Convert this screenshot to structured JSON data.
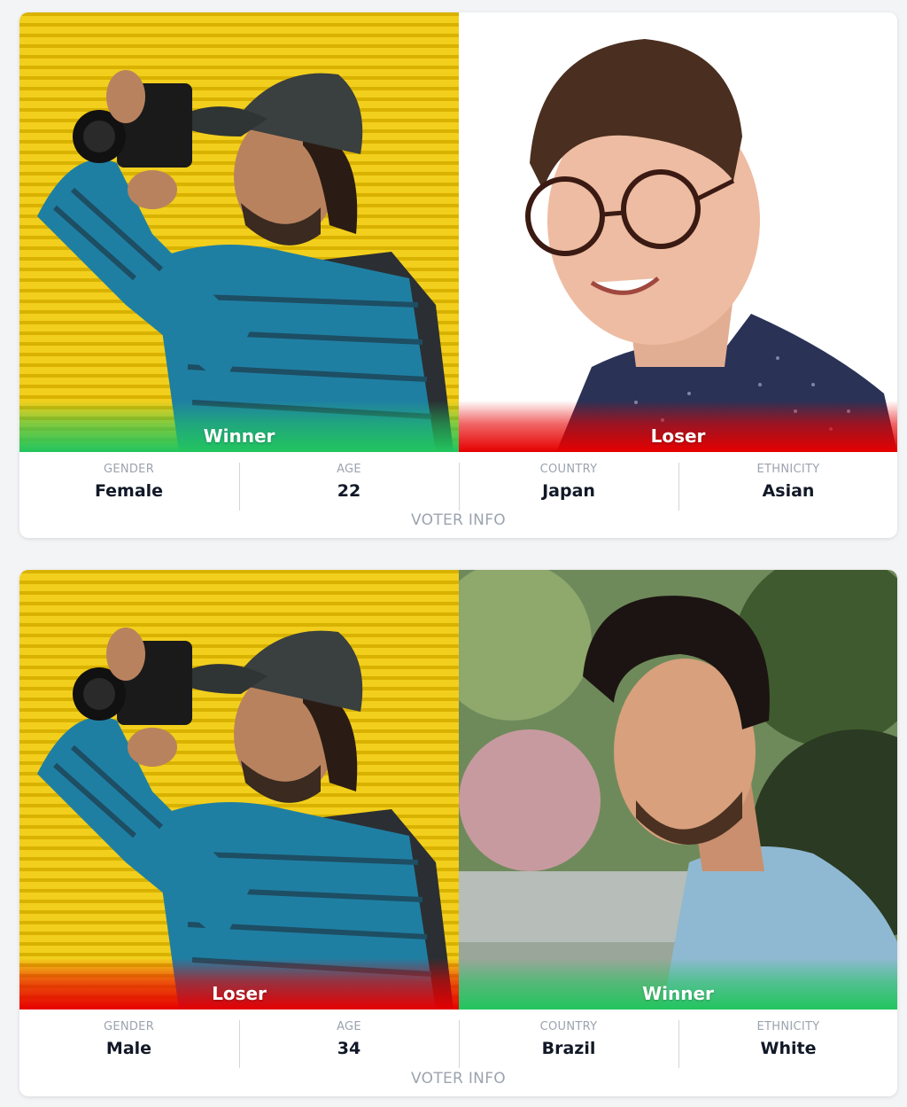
{
  "comparisons": [
    {
      "left": {
        "result": "Winner",
        "photo": "photographer-yellow-wall-photo"
      },
      "right": {
        "result": "Loser",
        "photo": "man-glasses-portrait-photo"
      },
      "stats": [
        {
          "key": "GENDER",
          "value": "Female"
        },
        {
          "key": "AGE",
          "value": "22"
        },
        {
          "key": "COUNTRY",
          "value": "Japan"
        },
        {
          "key": "ETHNICITY",
          "value": "Asian"
        }
      ],
      "footer": "VOTER INFO"
    },
    {
      "left": {
        "result": "Loser",
        "photo": "photographer-yellow-wall-photo"
      },
      "right": {
        "result": "Winner",
        "photo": "man-outdoor-portrait-photo"
      },
      "stats": [
        {
          "key": "GENDER",
          "value": "Male"
        },
        {
          "key": "AGE",
          "value": "34"
        },
        {
          "key": "COUNTRY",
          "value": "Brazil"
        },
        {
          "key": "ETHNICITY",
          "value": "White"
        }
      ],
      "footer": "VOTER INFO"
    }
  ],
  "colors": {
    "winner": "#22c55e",
    "loser": "#e60000",
    "muted": "#9ca3af"
  }
}
